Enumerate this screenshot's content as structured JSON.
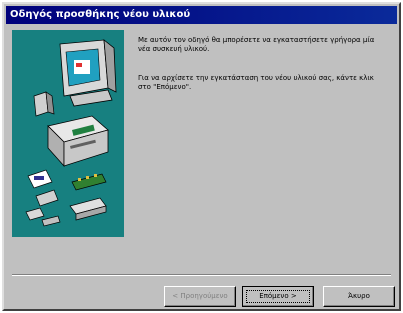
{
  "window": {
    "title": "Οδηγός προσθήκης νέου υλικού"
  },
  "content": {
    "paragraph_1": "Με αυτόν τον οδηγό θα μπορέσετε να εγκαταστήσετε γρήγορα μία νέα συσκευή υλικού.",
    "paragraph_2": "Για να αρχίσετε την εγκατάσταση του νέου υλικού σας, κάντε κλικ στο \"Επόμενο\"."
  },
  "buttons": {
    "back_label": "< Προηγούμενο",
    "next_label": "Επόμενο >",
    "cancel_label": "Άκυρο"
  },
  "colors": {
    "titlebar": "#00007b",
    "illustration_bg": "#178080",
    "window_bg": "#c0c0c0"
  },
  "icons": [
    "computer-icon",
    "monitor-icon",
    "speaker-icon",
    "system-unit-icon",
    "sound-card-icon",
    "modem-icon",
    "chip-icon",
    "drive-icon"
  ]
}
